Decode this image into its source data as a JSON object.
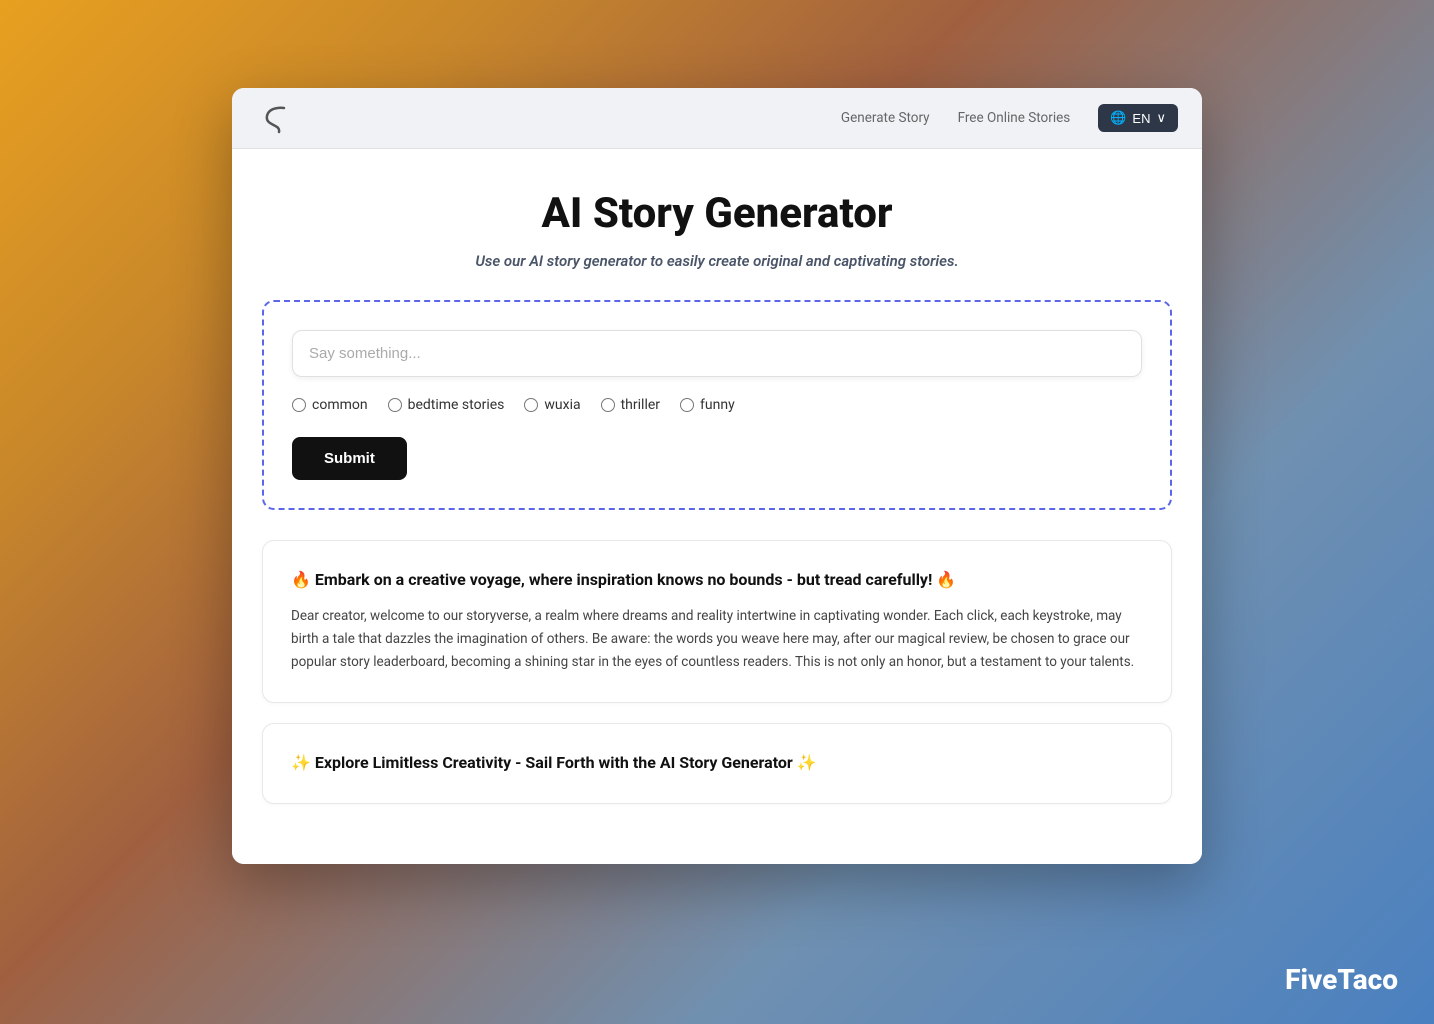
{
  "nav": {
    "generate_story": "Generate Story",
    "free_stories": "Free Online Stories",
    "lang": "EN",
    "lang_icon": "🌐"
  },
  "hero": {
    "title": "AI Story Generator",
    "subtitle": "Use our AI story generator to easily create original and captivating stories."
  },
  "form": {
    "placeholder": "Say something...",
    "genres": [
      {
        "id": "common",
        "label": "common",
        "selected": false
      },
      {
        "id": "bedtime",
        "label": "bedtime stories",
        "selected": false
      },
      {
        "id": "wuxia",
        "label": "wuxia",
        "selected": false
      },
      {
        "id": "thriller",
        "label": "thriller",
        "selected": false
      },
      {
        "id": "funny",
        "label": "funny",
        "selected": false
      }
    ],
    "submit_label": "Submit"
  },
  "cards": [
    {
      "id": "card1",
      "title": "🔥 Embark on a creative voyage, where inspiration knows no bounds - but tread carefully! 🔥",
      "body": "Dear creator, welcome to our storyverse, a realm where dreams and reality intertwine in captivating wonder. Each click, each keystroke, may birth a tale that dazzles the imagination of others. Be aware: the words you weave here may, after our magical review, be chosen to grace our popular story leaderboard, becoming a shining star in the eyes of countless readers. This is not only an honor, but a testament to your talents."
    },
    {
      "id": "card2",
      "title": "✨ Explore Limitless Creativity - Sail Forth with the AI Story Generator ✨"
    }
  ],
  "footer": {
    "brand": "FiveTaco"
  }
}
